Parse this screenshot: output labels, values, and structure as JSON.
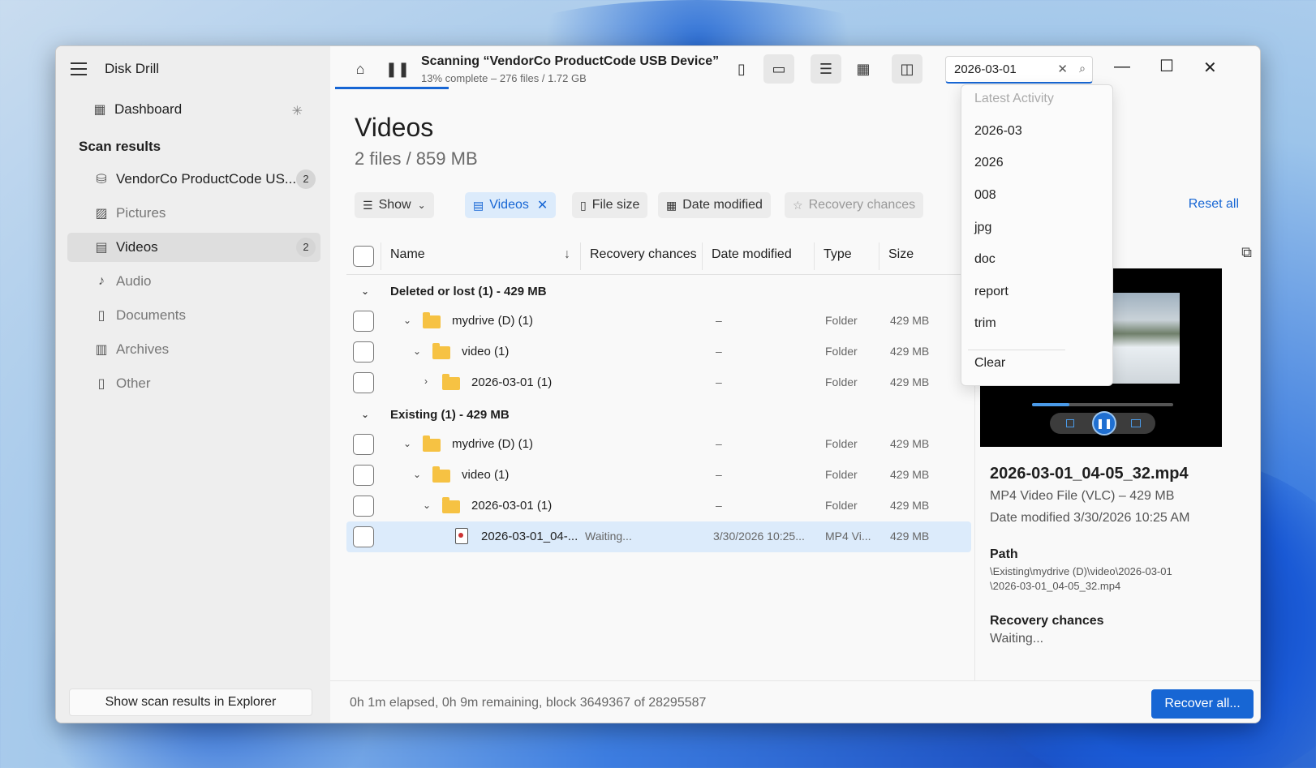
{
  "app": {
    "title": "Disk Drill"
  },
  "sidebar": {
    "dashboard_label": "Dashboard",
    "scan_results_label": "Scan results",
    "items": [
      {
        "label": "VendorCo ProductCode US...",
        "count": "2",
        "icon": "drive-icon"
      },
      {
        "label": "Pictures",
        "icon": "image-icon"
      },
      {
        "label": "Videos",
        "count": "2",
        "icon": "film-icon"
      },
      {
        "label": "Audio",
        "icon": "music-icon"
      },
      {
        "label": "Documents",
        "icon": "document-icon"
      },
      {
        "label": "Archives",
        "icon": "archive-icon"
      },
      {
        "label": "Other",
        "icon": "file-icon"
      }
    ],
    "explorer_button": "Show scan results in Explorer"
  },
  "topbar": {
    "scan_title": "Scanning “VendorCo ProductCode USB Device”",
    "scan_subtitle": "13% complete – 276 files / 1.72 GB",
    "scan_progress": 0.13,
    "search_value": "2026-03-01"
  },
  "search_dropdown": {
    "header": "Latest Activity",
    "items": [
      "2026-03",
      "2026",
      "008",
      "jpg",
      "doc",
      "report",
      "trim"
    ],
    "clear": "Clear"
  },
  "main": {
    "heading": "Videos",
    "subheading": "2 files / 859 MB",
    "filters": {
      "show": "Show",
      "videos": "Videos",
      "file_size": "File size",
      "date_modified": "Date modified",
      "recovery_chances": "Recovery chances",
      "reset_all": "Reset all"
    },
    "columns": {
      "name": "Name",
      "recovery": "Recovery chances",
      "date": "Date modified",
      "type": "Type",
      "size": "Size"
    },
    "groups": [
      {
        "label": "Deleted or lost (1) - 429 MB",
        "rows": [
          {
            "name": "mydrive (D) (1)",
            "date": "–",
            "type": "Folder",
            "size": "429 MB"
          },
          {
            "name": "video (1)",
            "date": "–",
            "type": "Folder",
            "size": "429 MB"
          },
          {
            "name": "2026-03-01 (1)",
            "date": "–",
            "type": "Folder",
            "size": "429 MB"
          }
        ]
      },
      {
        "label": "Existing (1) - 429 MB",
        "rows": [
          {
            "name": "mydrive (D) (1)",
            "date": "–",
            "type": "Folder",
            "size": "429 MB"
          },
          {
            "name": "video (1)",
            "date": "–",
            "type": "Folder",
            "size": "429 MB"
          },
          {
            "name": "2026-03-01 (1)",
            "date": "–",
            "type": "Folder",
            "size": "429 MB"
          },
          {
            "name": "2026-03-01_04-...",
            "recovery": "Waiting...",
            "date": "3/30/2026 10:25...",
            "type": "MP4 Vi...",
            "size": "429 MB"
          }
        ]
      }
    ]
  },
  "preview": {
    "filename": "2026-03-01_04-05_32.mp4",
    "file_info": "MP4 Video File (VLC) – 429 MB",
    "date_modified": "Date modified 3/30/2026 10:25 AM",
    "path_label": "Path",
    "path_line1": "\\Existing\\mydrive (D)\\video\\2026-03-01",
    "path_line2": "\\2026-03-01_04-05_32.mp4",
    "recovery_label": "Recovery chances",
    "recovery_value": "Waiting..."
  },
  "status": {
    "text": "0h 1m elapsed, 0h 9m remaining, block 3649367 of 28295587",
    "recover_all": "Recover all..."
  }
}
